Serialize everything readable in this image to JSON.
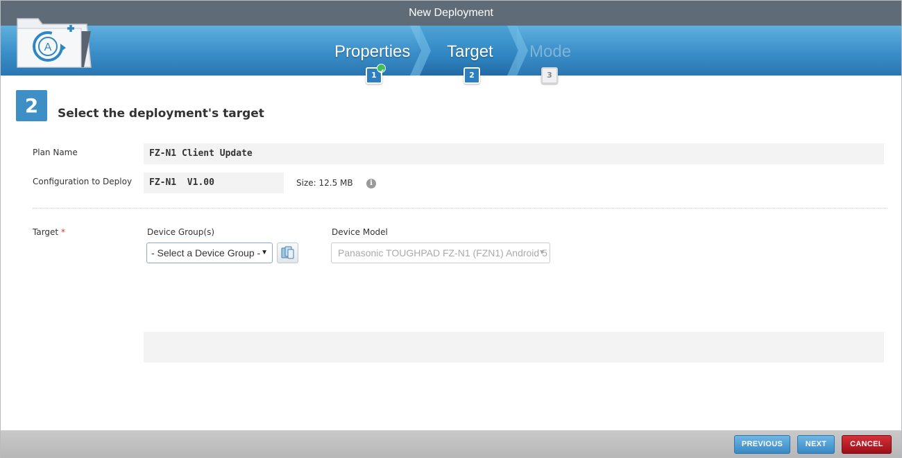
{
  "window": {
    "title": "New Deployment"
  },
  "wizard": {
    "steps": [
      {
        "label": "Properties",
        "number": "1",
        "state": "completed"
      },
      {
        "label": "Target",
        "number": "2",
        "state": "active"
      },
      {
        "label": "Mode",
        "number": "3",
        "state": "disabled"
      }
    ]
  },
  "section": {
    "number": "2",
    "title": "Select the deployment's target"
  },
  "form": {
    "plan_name_label": "Plan Name",
    "plan_name_value": "FZ-N1 Client Update",
    "config_label": "Configuration to Deploy",
    "config_value": "FZ-N1  V1.00",
    "size_text": "Size: 12.5 MB",
    "target_label": "Target",
    "required_mark": "*",
    "device_groups_label": "Device Group(s)",
    "device_group_selected": "- Select a Device Group -",
    "device_model_label": "Device Model",
    "device_model_selected": "Panasonic TOUGHPAD FZ-N1 (FZN1) Android 5"
  },
  "footer": {
    "previous": "PREVIOUS",
    "next": "NEXT",
    "cancel": "CANCEL"
  },
  "colors": {
    "accent": "#3d8fc6",
    "header": "#5f6c78",
    "cancel": "#b0151e",
    "success": "#3fbf5c"
  }
}
